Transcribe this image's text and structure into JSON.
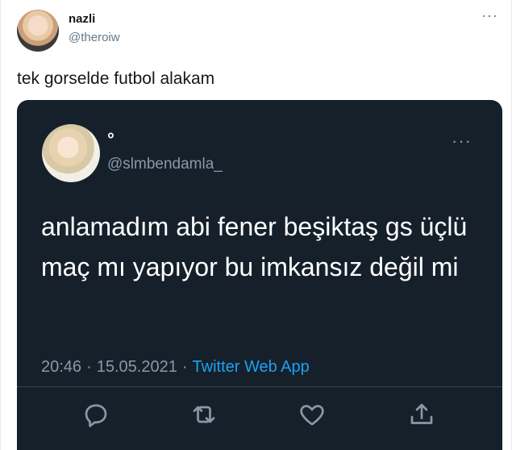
{
  "outer_tweet": {
    "name": "nazli",
    "handle": "@theroiw",
    "text": "tek gorselde futbol alakam",
    "more_icon": "more-horizontal-icon"
  },
  "quoted_tweet": {
    "name": "°",
    "handle": "@slmbendamla_",
    "text": "anlamadım abi fener beşiktaş gs üçlü maç mı yapıyor bu imkansız değil mi",
    "time": "20:46",
    "date": "15.05.2021",
    "separator": "·",
    "source": "Twitter Web App",
    "more_icon": "more-horizontal-icon",
    "actions": [
      "reply-icon",
      "retweet-icon",
      "like-icon",
      "share-icon"
    ]
  },
  "colors": {
    "card_background": "#15202b",
    "link": "#1da1f2",
    "muted": "#8899a6"
  }
}
